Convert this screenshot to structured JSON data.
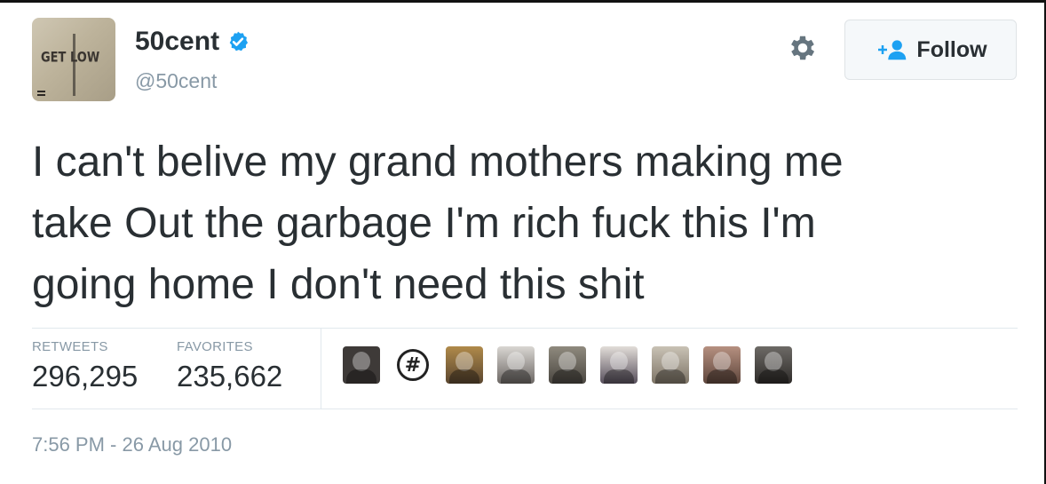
{
  "user": {
    "display_name": "50cent",
    "handle": "@50cent",
    "avatar_text": "GET LOW",
    "verified": true
  },
  "actions": {
    "settings_icon": "gear-icon",
    "follow_label": "Follow",
    "follow_icon": "add-user-icon"
  },
  "tweet": {
    "lines": [
      "I can't belive my grand mothers making me",
      "take Out the garbage I'm rich fuck this I'm",
      "going home I don't need this shit"
    ]
  },
  "stats": {
    "retweets_label": "RETWEETS",
    "retweets_value": "296,295",
    "favorites_label": "FAVORITES",
    "favorites_value": "235,662"
  },
  "favorited_by_count": 9,
  "timestamp": "7:56 PM - 26 Aug 2010",
  "colors": {
    "text": "#292f33",
    "muted": "#8899a6",
    "verified": "#1da1f2",
    "follow_icon": "#1da1f2",
    "border": "#e1e8ed"
  }
}
